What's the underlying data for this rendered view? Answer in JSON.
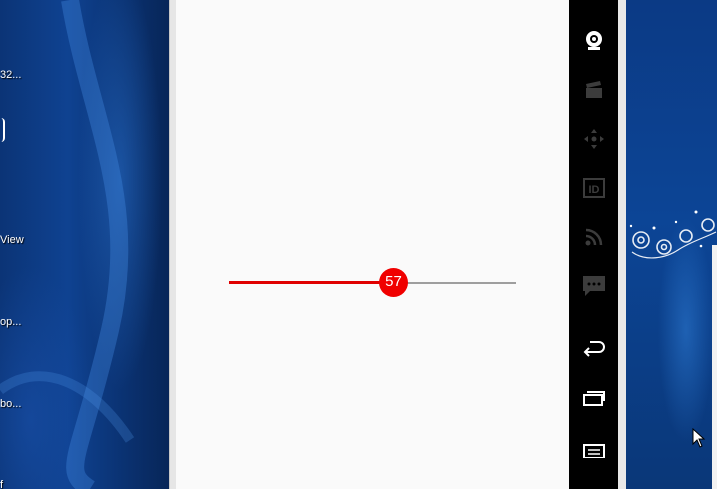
{
  "desktop": {
    "icons": [
      {
        "label": "32..."
      },
      {
        "label": "View"
      },
      {
        "label": "op..."
      },
      {
        "label": "bo..."
      },
      {
        "label": "f"
      }
    ]
  },
  "emulator": {
    "seekbar": {
      "value": 57,
      "value_label": "57",
      "fill_fraction": 0.57,
      "progress_color": "#e00000",
      "thumb_color": "#f00000",
      "track_color": "#9e9e9e"
    },
    "toolbar": {
      "buttons": [
        {
          "icon": "webcam-icon",
          "enabled": true
        },
        {
          "icon": "clapperboard-icon",
          "enabled": false
        },
        {
          "icon": "dpad-icon",
          "enabled": false
        },
        {
          "icon": "id-icon",
          "enabled": false,
          "text": "ID"
        },
        {
          "icon": "rss-icon",
          "enabled": false
        },
        {
          "icon": "sms-icon",
          "enabled": false
        },
        {
          "icon": "back-icon",
          "enabled": true
        },
        {
          "icon": "recent-apps-icon",
          "enabled": true
        },
        {
          "icon": "menu-icon",
          "enabled": true
        }
      ]
    }
  }
}
